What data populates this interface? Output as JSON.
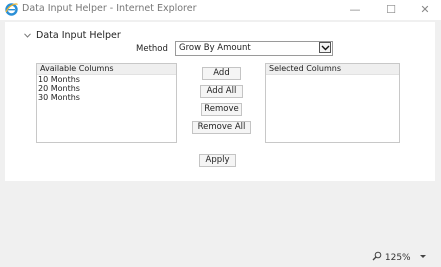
{
  "window": {
    "title": "Data Input Helper - Internet Explorer",
    "icon": "ie-logo-icon",
    "minimize_glyph": "—",
    "maximize_glyph": "☐",
    "close_glyph": "✕"
  },
  "panel": {
    "header": "Data Input Helper",
    "collapse_icon": "chevron-down-icon",
    "method_label": "Method",
    "method_value": "Grow By Amount"
  },
  "available_columns": {
    "header": "Available Columns",
    "items": [
      "10 Months",
      "20 Months",
      "30 Months"
    ]
  },
  "selected_columns": {
    "header": "Selected Columns",
    "items": []
  },
  "buttons": {
    "add": "Add",
    "add_all": "Add All",
    "remove": "Remove",
    "remove_all": "Remove All",
    "apply": "Apply"
  },
  "statusbar": {
    "zoom": "125%"
  }
}
